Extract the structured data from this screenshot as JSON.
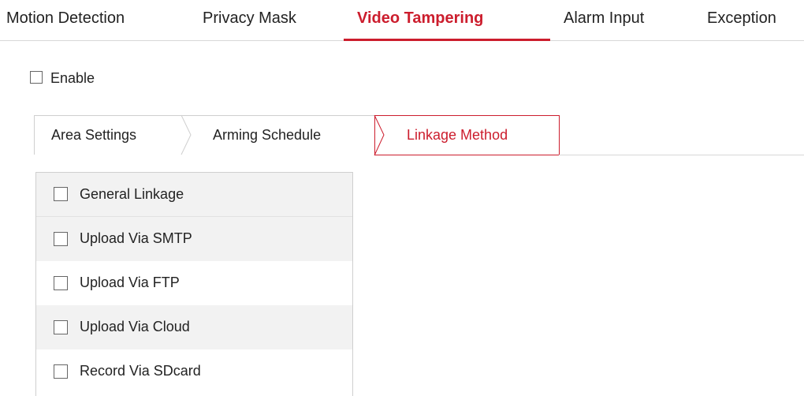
{
  "top_tabs": [
    {
      "label": "Motion Detection",
      "active": false
    },
    {
      "label": "Privacy Mask",
      "active": false
    },
    {
      "label": "Video Tampering",
      "active": true
    },
    {
      "label": "Alarm Input",
      "active": false
    },
    {
      "label": "Exception",
      "active": false
    }
  ],
  "enable": {
    "label": "Enable",
    "checked": false
  },
  "sub_tabs": [
    {
      "label": "Area Settings",
      "active": false
    },
    {
      "label": "Arming Schedule",
      "active": false
    },
    {
      "label": "Linkage Method",
      "active": true
    }
  ],
  "linkage": {
    "header": {
      "label": "General Linkage",
      "checked": false
    },
    "items": [
      {
        "label": "Upload Via SMTP",
        "checked": false
      },
      {
        "label": "Upload Via FTP",
        "checked": false
      },
      {
        "label": "Upload Via Cloud",
        "checked": false
      },
      {
        "label": "Record Via SDcard",
        "checked": false
      }
    ]
  },
  "colors": {
    "accent": "#cc1d2d",
    "border": "#cfcfcf",
    "row_shade": "#f2f2f2"
  }
}
